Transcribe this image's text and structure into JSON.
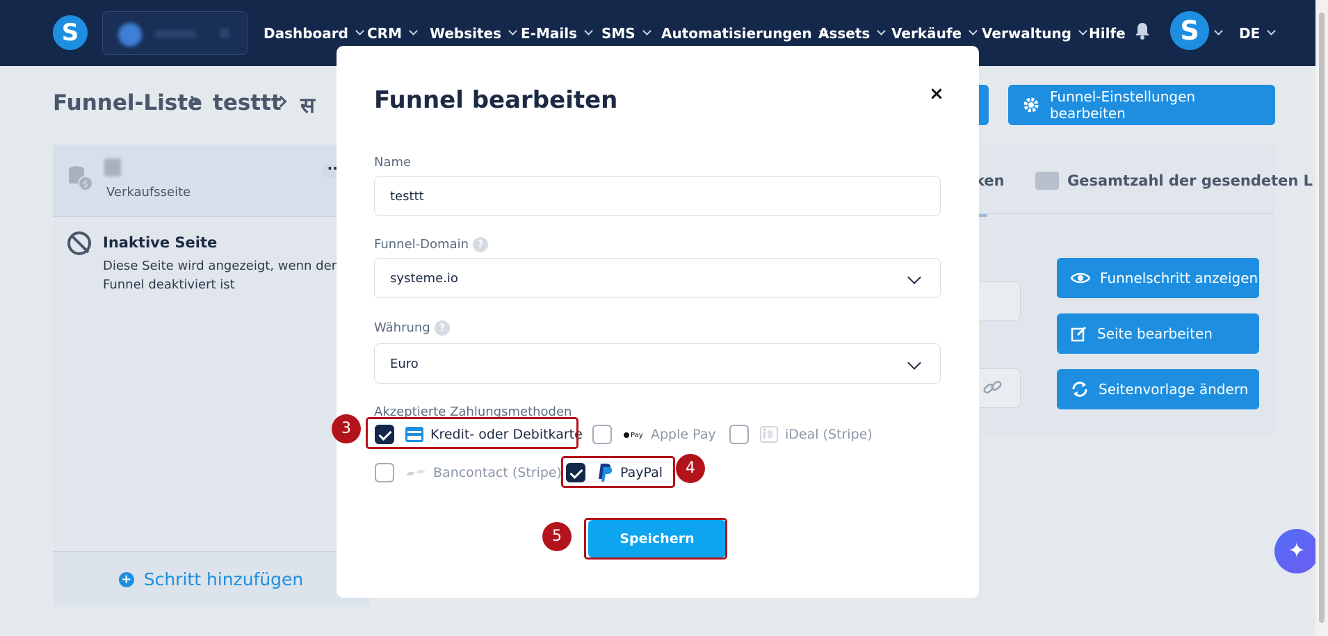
{
  "nav": {
    "logo": "S",
    "items": [
      {
        "label": "Dashboard",
        "dropdown": true
      },
      {
        "label": "CRM",
        "dropdown": true
      },
      {
        "label": "Websites",
        "dropdown": true
      },
      {
        "label": "E-Mails",
        "dropdown": true
      },
      {
        "label": "SMS",
        "dropdown": true
      },
      {
        "label": "Automatisierungen",
        "dropdown": true
      },
      {
        "label": "Assets",
        "dropdown": true
      },
      {
        "label": "Verkäufe",
        "dropdown": true
      },
      {
        "label": "Verwaltung",
        "dropdown": true
      },
      {
        "label": "Hilfe",
        "dropdown": false
      }
    ],
    "avatar": "S",
    "language": "DE"
  },
  "breadcrumb": [
    "Funnel-Liste",
    "testtt",
    "स"
  ],
  "header_buttons": {
    "settings": "Funnel-Einstellungen bearbeiten"
  },
  "step": {
    "type": "Verkaufsseite"
  },
  "inactive": {
    "title": "Inaktive Seite",
    "description": "Diese Seite wird angezeigt, wenn der Funnel deaktiviert ist"
  },
  "add_step": "Schritt hinzufügen",
  "tabs": {
    "partial": "ken",
    "total_sent": "Gesamtzahl der gesendeten L"
  },
  "actions": {
    "view": "Funnelschritt anzeigen",
    "edit": "Seite bearbeiten",
    "change_template": "Seitenvorlage ändern"
  },
  "modal": {
    "title": "Funnel bearbeiten",
    "close": "×",
    "name_label": "Name",
    "name_value": "testtt",
    "domain_label": "Funnel-Domain",
    "domain_value": "systeme.io",
    "currency_label": "Währung",
    "currency_value": "Euro",
    "payment_label": "Akzeptierte Zahlungsmethoden",
    "payment_methods": [
      {
        "label": "Kredit- oder Debitkarte",
        "checked": true
      },
      {
        "label": "Apple Pay",
        "checked": false
      },
      {
        "label": "iDeal (Stripe)",
        "checked": false
      },
      {
        "label": "Bancontact (Stripe)",
        "checked": false
      },
      {
        "label": "PayPal",
        "checked": true
      }
    ],
    "save": "Speichern"
  },
  "annotations": [
    "3",
    "4",
    "5"
  ],
  "colors": {
    "nav_bg": "#14284b",
    "primary": "#1e8fe0",
    "save": "#0ea5f0",
    "annotation": "#b3131b"
  }
}
